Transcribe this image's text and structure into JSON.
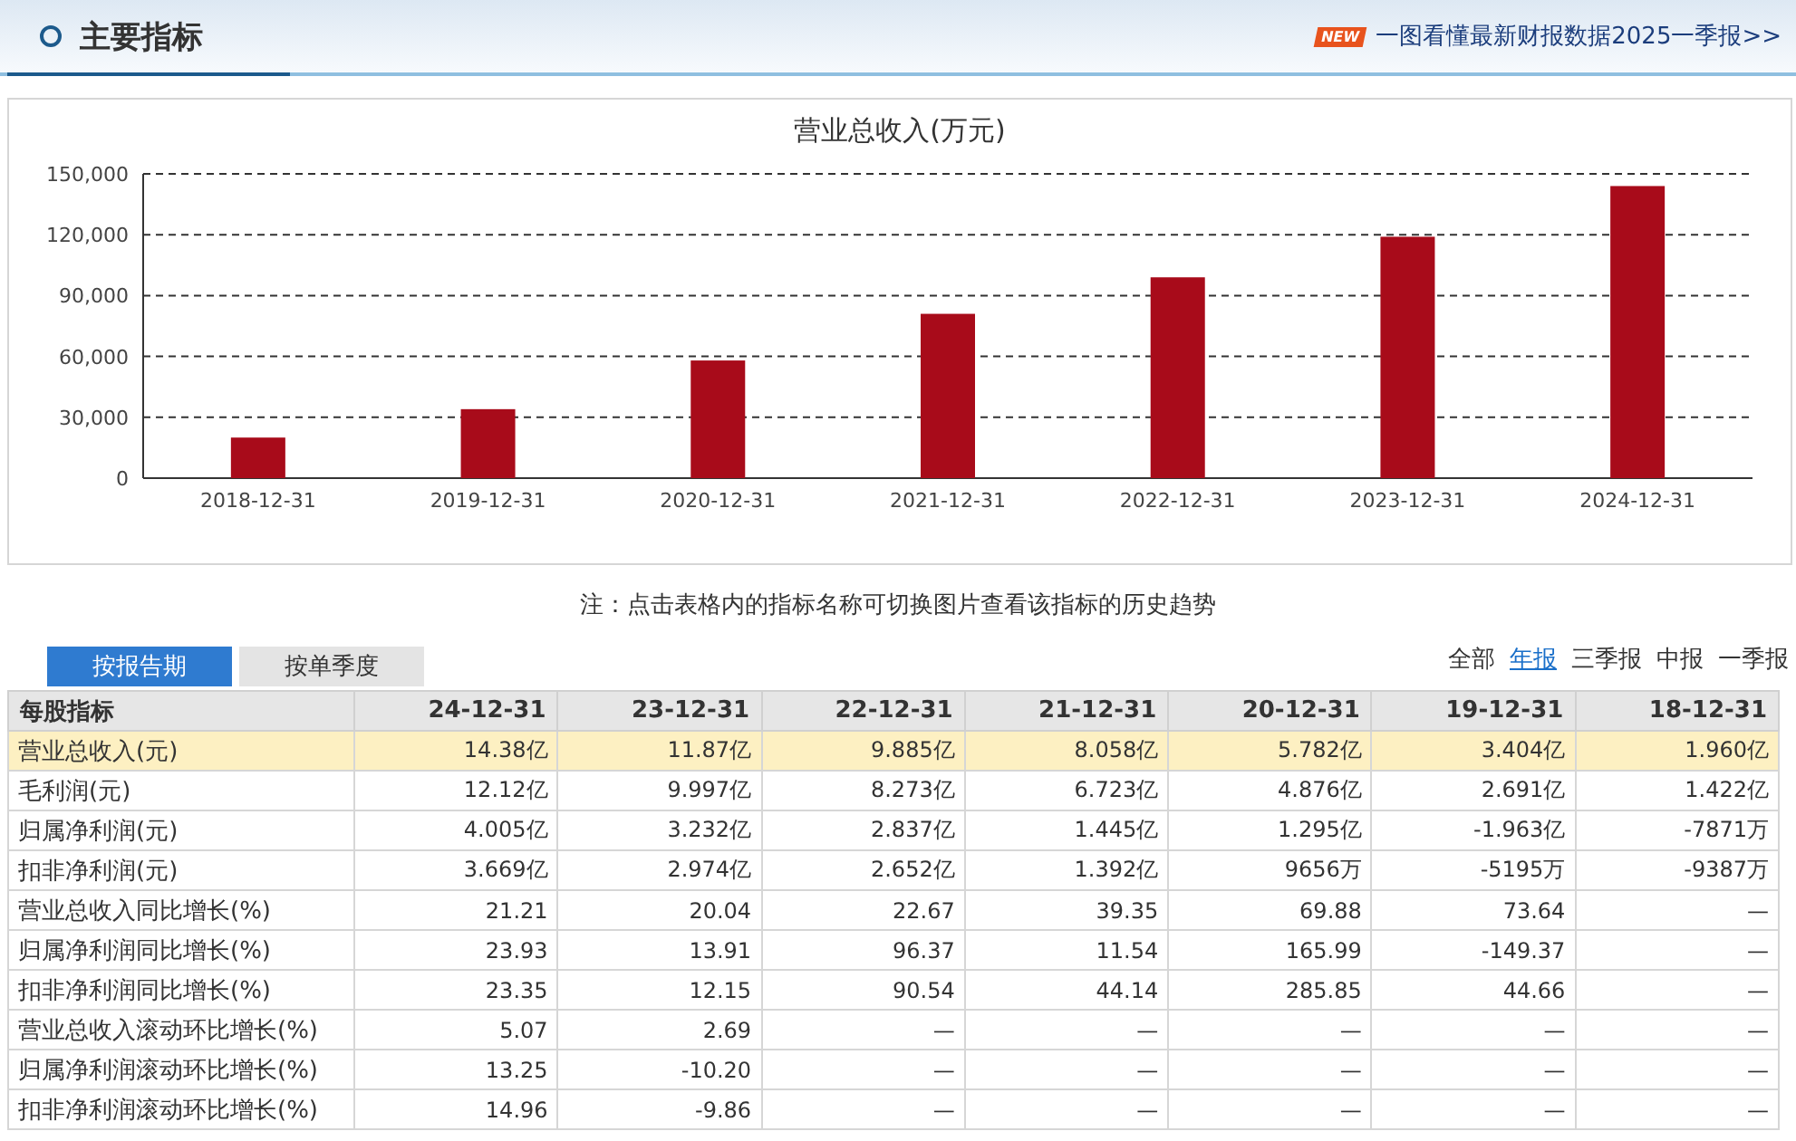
{
  "header": {
    "title": "主要指标",
    "badge": "NEW",
    "link": "一图看懂最新财报数据2025一季报>>"
  },
  "chart": {
    "chart_data": {
      "type": "bar",
      "title": "营业总收入(万元)",
      "categories": [
        "2018-12-31",
        "2019-12-31",
        "2020-12-31",
        "2021-12-31",
        "2022-12-31",
        "2023-12-31",
        "2024-12-31"
      ],
      "grid": true,
      "series": [
        {
          "color": "#a80b1a",
          "values": [
            20000,
            34000,
            58000,
            81000,
            99000,
            119000,
            144000
          ]
        }
      ],
      "ylim": [
        0,
        150000
      ],
      "yticks": [
        {
          "value": 0,
          "label": "0"
        },
        {
          "value": 30000,
          "label": "30,000"
        },
        {
          "value": 60000,
          "label": "60,000"
        },
        {
          "value": 90000,
          "label": "90,000"
        },
        {
          "value": 120000,
          "label": "120,000"
        },
        {
          "value": 150000,
          "label": "150,000"
        }
      ]
    }
  },
  "note": "注：点击表格内的指标名称可切换图片查看该指标的历史趋势",
  "tabs": [
    {
      "label": "按报告期",
      "selected": true
    },
    {
      "label": "按单季度",
      "selected": false
    }
  ],
  "periods": [
    {
      "label": "全部",
      "selected": false
    },
    {
      "label": "年报",
      "selected": true
    },
    {
      "label": "三季报",
      "selected": false
    },
    {
      "label": "中报",
      "selected": false
    },
    {
      "label": "一季报",
      "selected": false
    }
  ],
  "table": {
    "columns": [
      "每股指标",
      "24-12-31",
      "23-12-31",
      "22-12-31",
      "21-12-31",
      "20-12-31",
      "19-12-31",
      "18-12-31"
    ],
    "rows": [
      {
        "selected": true,
        "cells": [
          "营业总收入(元)",
          "14.38亿",
          "11.87亿",
          "9.885亿",
          "8.058亿",
          "5.782亿",
          "3.404亿",
          "1.960亿"
        ]
      },
      {
        "selected": false,
        "cells": [
          "毛利润(元)",
          "12.12亿",
          "9.997亿",
          "8.273亿",
          "6.723亿",
          "4.876亿",
          "2.691亿",
          "1.422亿"
        ]
      },
      {
        "selected": false,
        "cells": [
          "归属净利润(元)",
          "4.005亿",
          "3.232亿",
          "2.837亿",
          "1.445亿",
          "1.295亿",
          "-1.963亿",
          "-7871万"
        ]
      },
      {
        "selected": false,
        "cells": [
          "扣非净利润(元)",
          "3.669亿",
          "2.974亿",
          "2.652亿",
          "1.392亿",
          "9656万",
          "-5195万",
          "-9387万"
        ]
      },
      {
        "selected": false,
        "cells": [
          "营业总收入同比增长(%)",
          "21.21",
          "20.04",
          "22.67",
          "39.35",
          "69.88",
          "73.64",
          "—"
        ]
      },
      {
        "selected": false,
        "cells": [
          "归属净利润同比增长(%)",
          "23.93",
          "13.91",
          "96.37",
          "11.54",
          "165.99",
          "-149.37",
          "—"
        ]
      },
      {
        "selected": false,
        "cells": [
          "扣非净利润同比增长(%)",
          "23.35",
          "12.15",
          "90.54",
          "44.14",
          "285.85",
          "44.66",
          "—"
        ]
      },
      {
        "selected": false,
        "cells": [
          "营业总收入滚动环比增长(%)",
          "5.07",
          "2.69",
          "—",
          "—",
          "—",
          "—",
          "—"
        ]
      },
      {
        "selected": false,
        "cells": [
          "归属净利润滚动环比增长(%)",
          "13.25",
          "-10.20",
          "—",
          "—",
          "—",
          "—",
          "—"
        ]
      },
      {
        "selected": false,
        "cells": [
          "扣非净利润滚动环比增长(%)",
          "14.96",
          "-9.86",
          "—",
          "—",
          "—",
          "—",
          "—"
        ]
      }
    ]
  }
}
